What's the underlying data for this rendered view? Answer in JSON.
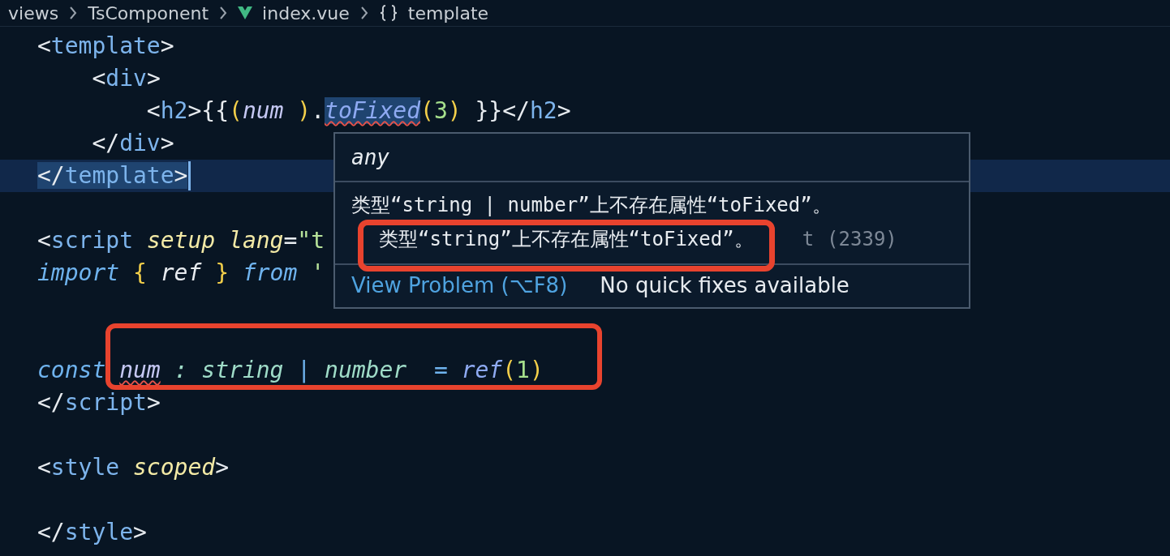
{
  "breadcrumb": [
    {
      "label": "views",
      "kind": "folder"
    },
    {
      "label": "TsComponent",
      "kind": "folder"
    },
    {
      "label": "index.vue",
      "kind": "vue"
    },
    {
      "label": "template",
      "kind": "symbol"
    }
  ],
  "editor": {
    "lines": [
      {
        "highlighted": false,
        "cursor": false,
        "tokens": [
          {
            "text": "<",
            "kind": "punct",
            "selected": false,
            "error": false
          },
          {
            "text": "template",
            "kind": "tag",
            "selected": false,
            "error": false
          },
          {
            "text": ">",
            "kind": "punct",
            "selected": false,
            "error": false
          }
        ]
      },
      {
        "highlighted": false,
        "cursor": false,
        "tokens": [
          {
            "text": "    <",
            "kind": "punct",
            "selected": false,
            "error": false
          },
          {
            "text": "div",
            "kind": "tag",
            "selected": false,
            "error": false
          },
          {
            "text": ">",
            "kind": "punct",
            "selected": false,
            "error": false
          }
        ]
      },
      {
        "highlighted": false,
        "cursor": false,
        "tokens": [
          {
            "text": "        <",
            "kind": "punct",
            "selected": false,
            "error": false
          },
          {
            "text": "h2",
            "kind": "tag",
            "selected": false,
            "error": false
          },
          {
            "text": ">{{",
            "kind": "punct",
            "selected": false,
            "error": false
          },
          {
            "text": "(",
            "kind": "brace",
            "selected": false,
            "error": false
          },
          {
            "text": "num ",
            "kind": "var",
            "selected": false,
            "error": false
          },
          {
            "text": ")",
            "kind": "brace",
            "selected": false,
            "error": false
          },
          {
            "text": ".",
            "kind": "punct",
            "selected": false,
            "error": false
          },
          {
            "text": "toFixed",
            "kind": "func",
            "selected": true,
            "error": true
          },
          {
            "text": "(",
            "kind": "brace",
            "selected": false,
            "error": false
          },
          {
            "text": "3",
            "kind": "number",
            "selected": false,
            "error": false
          },
          {
            "text": ")",
            "kind": "brace",
            "selected": false,
            "error": false
          },
          {
            "text": " }}</",
            "kind": "punct",
            "selected": false,
            "error": false
          },
          {
            "text": "h2",
            "kind": "tag",
            "selected": false,
            "error": false
          },
          {
            "text": ">",
            "kind": "punct",
            "selected": false,
            "error": false
          }
        ]
      },
      {
        "highlighted": false,
        "cursor": false,
        "tokens": [
          {
            "text": "    </",
            "kind": "punct",
            "selected": false,
            "error": false
          },
          {
            "text": "div",
            "kind": "tag",
            "selected": false,
            "error": false
          },
          {
            "text": ">",
            "kind": "punct",
            "selected": false,
            "error": false
          }
        ]
      },
      {
        "highlighted": true,
        "cursor": true,
        "tokens": [
          {
            "text": "</",
            "kind": "punct",
            "selected": true,
            "error": false
          },
          {
            "text": "template",
            "kind": "tag",
            "selected": true,
            "error": false
          },
          {
            "text": ">",
            "kind": "punct",
            "selected": true,
            "error": false
          }
        ]
      },
      {
        "highlighted": false,
        "cursor": false
      },
      {
        "highlighted": false,
        "cursor": false,
        "tokens": [
          {
            "text": "<",
            "kind": "punct",
            "selected": false,
            "error": false
          },
          {
            "text": "script ",
            "kind": "tag",
            "selected": false,
            "error": false
          },
          {
            "text": "setup lang",
            "kind": "attr",
            "selected": false,
            "error": false
          },
          {
            "text": "=",
            "kind": "punct",
            "selected": false,
            "error": false
          },
          {
            "text": "\"t",
            "kind": "string",
            "selected": false,
            "error": false
          }
        ]
      },
      {
        "highlighted": false,
        "cursor": false,
        "tokens": [
          {
            "text": "import ",
            "kind": "keyword",
            "selected": false,
            "error": false
          },
          {
            "text": "{",
            "kind": "brace",
            "selected": false,
            "error": false
          },
          {
            "text": " ref ",
            "kind": "ident",
            "selected": false,
            "error": false
          },
          {
            "text": "}",
            "kind": "brace",
            "selected": false,
            "error": false
          },
          {
            "text": " from",
            "kind": "keyword",
            "selected": false,
            "error": false
          },
          {
            "text": " '",
            "kind": "string",
            "selected": false,
            "error": false
          }
        ]
      },
      {
        "highlighted": false,
        "cursor": false
      },
      {
        "highlighted": false,
        "cursor": false
      },
      {
        "highlighted": false,
        "cursor": false,
        "tokens": [
          {
            "text": "const ",
            "kind": "keyword",
            "selected": false,
            "error": false
          },
          {
            "text": "num",
            "kind": "var",
            "selected": false,
            "error": true
          },
          {
            "text": " : string",
            "kind": "type",
            "selected": false,
            "error": false
          },
          {
            "text": " | ",
            "kind": "keyword",
            "selected": false,
            "error": false
          },
          {
            "text": "number",
            "kind": "type",
            "selected": false,
            "error": false
          },
          {
            "text": "  = ",
            "kind": "keyword",
            "selected": false,
            "error": false
          },
          {
            "text": "ref",
            "kind": "func",
            "selected": false,
            "error": false
          },
          {
            "text": "(",
            "kind": "brace",
            "selected": false,
            "error": false
          },
          {
            "text": "1",
            "kind": "number",
            "selected": false,
            "error": false
          },
          {
            "text": ")",
            "kind": "brace",
            "selected": false,
            "error": false
          }
        ]
      },
      {
        "highlighted": false,
        "cursor": false,
        "tokens": [
          {
            "text": "</",
            "kind": "punct",
            "selected": false,
            "error": false
          },
          {
            "text": "script",
            "kind": "tag",
            "selected": false,
            "error": false
          },
          {
            "text": ">",
            "kind": "punct",
            "selected": false,
            "error": false
          }
        ]
      },
      {
        "highlighted": false,
        "cursor": false
      },
      {
        "highlighted": false,
        "cursor": false,
        "tokens": [
          {
            "text": "<",
            "kind": "punct",
            "selected": false,
            "error": false
          },
          {
            "text": "style ",
            "kind": "tag",
            "selected": false,
            "error": false
          },
          {
            "text": "scoped",
            "kind": "attr",
            "selected": false,
            "error": false
          },
          {
            "text": ">",
            "kind": "punct",
            "selected": false,
            "error": false
          }
        ]
      },
      {
        "highlighted": false,
        "cursor": false
      },
      {
        "highlighted": false,
        "cursor": false,
        "tokens": [
          {
            "text": "</",
            "kind": "punct",
            "selected": false,
            "error": false
          },
          {
            "text": "style",
            "kind": "tag",
            "selected": false,
            "error": false
          },
          {
            "text": ">",
            "kind": "punct",
            "selected": false,
            "error": false
          }
        ]
      }
    ]
  },
  "hover": {
    "type": "any",
    "message": "类型“string | number”上不存在属性“toFixed”。",
    "detail": "类型“string”上不存在属性“toFixed”。",
    "source": "t",
    "code": "(2339)",
    "actions": [
      {
        "label": "View Problem (⌥F8)",
        "kind": "link"
      },
      {
        "label": "No quick fixes available",
        "kind": "note"
      }
    ]
  }
}
